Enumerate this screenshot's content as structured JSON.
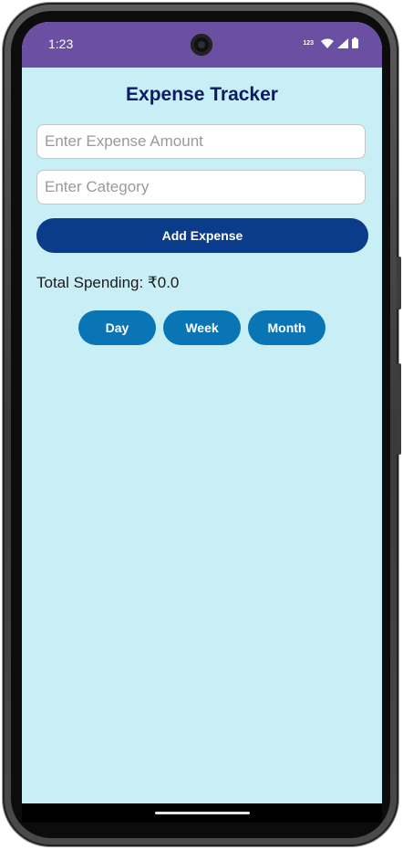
{
  "status_bar": {
    "time": "1:23",
    "network_label": "123",
    "icons": [
      "wifi-icon",
      "signal-icon",
      "battery-icon"
    ]
  },
  "app": {
    "title": "Expense Tracker",
    "amount_field": {
      "placeholder": "Enter Expense Amount",
      "value": ""
    },
    "category_field": {
      "placeholder": "Enter Category",
      "value": ""
    },
    "add_button_label": "Add Expense",
    "total_label": "Total Spending: ₹0.0",
    "period_buttons": [
      {
        "label": "Day"
      },
      {
        "label": "Week"
      },
      {
        "label": "Month"
      }
    ]
  },
  "colors": {
    "status_bar": "#6a4fa3",
    "background": "#c8eef6",
    "title": "#0d1a66",
    "add_button": "#0b3c8a",
    "period_button": "#0a75b5"
  }
}
